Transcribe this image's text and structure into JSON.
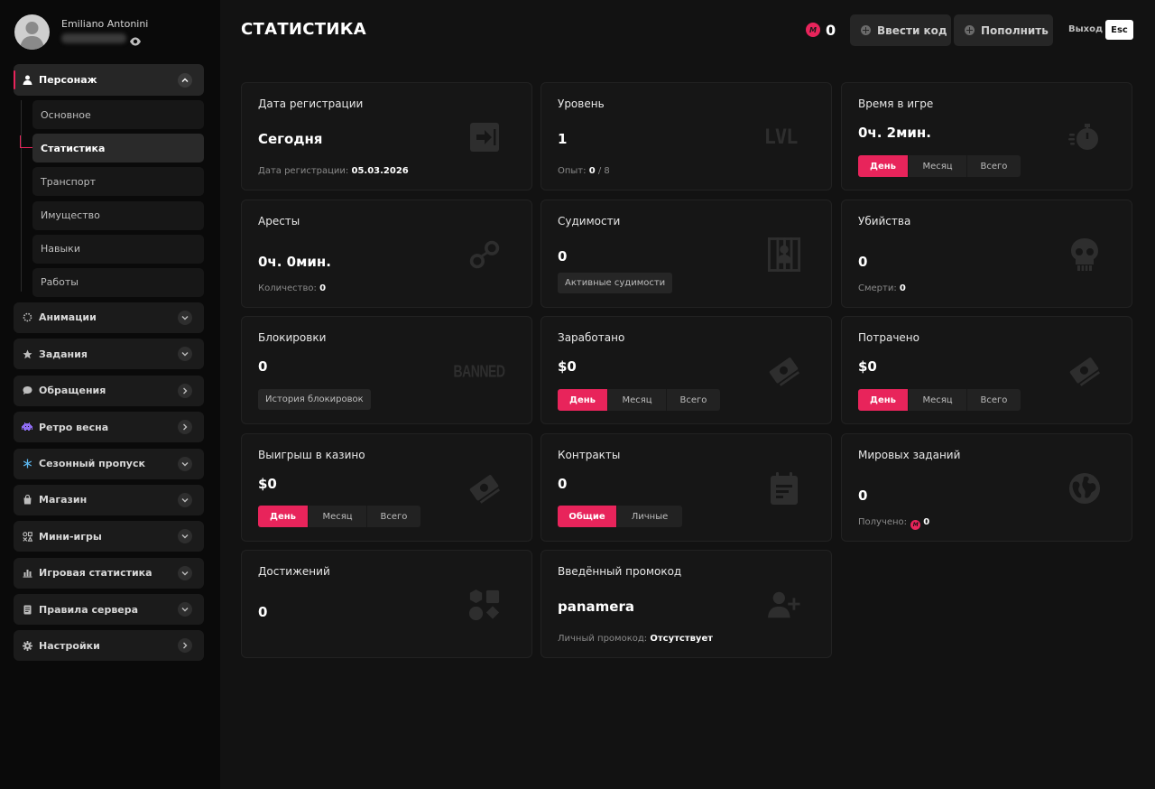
{
  "sidebar": {
    "profile": {
      "name": "Emiliano Antonini"
    },
    "menu": [
      {
        "label": "Персонаж"
      },
      {
        "label": "Анимации"
      },
      {
        "label": "Задания"
      },
      {
        "label": "Обращения"
      },
      {
        "label": "Ретро весна"
      },
      {
        "label": "Сезонный пропуск"
      },
      {
        "label": "Магазин"
      },
      {
        "label": "Мини-игры"
      },
      {
        "label": "Игровая статистика"
      },
      {
        "label": "Правила сервера"
      },
      {
        "label": "Настройки"
      }
    ],
    "submenu": [
      {
        "label": "Основное"
      },
      {
        "label": "Статистика"
      },
      {
        "label": "Транспорт"
      },
      {
        "label": "Имущество"
      },
      {
        "label": "Навыки"
      },
      {
        "label": "Работы"
      }
    ]
  },
  "header": {
    "title": "СТАТИСТИКА",
    "coin_glyph": "M",
    "balance": "0",
    "enter_code": "Ввести код",
    "top_up": "Пополнить",
    "exit_label": "Выход",
    "exit_key": "Esc"
  },
  "cards": {
    "registration": {
      "title": "Дата регистрации",
      "value": "Сегодня",
      "sub_label": "Дата регистрации:",
      "sub_value": "05.03.2026"
    },
    "level": {
      "title": "Уровень",
      "value": "1",
      "sub_label": "Опыт:",
      "sub_value": "0",
      "sub_suffix": "/ 8",
      "icon_text": "LVL"
    },
    "playtime": {
      "title": "Время в игре",
      "value": "0ч. 2мин.",
      "tabs": [
        "День",
        "Месяц",
        "Всего"
      ]
    },
    "arrests": {
      "title": "Аресты",
      "value": "0ч. 0мин.",
      "sub_label": "Количество:",
      "sub_value": "0"
    },
    "convictions": {
      "title": "Судимости",
      "value": "0",
      "button": "Активные судимости"
    },
    "kills": {
      "title": "Убийства",
      "value": "0",
      "sub_label": "Смерти:",
      "sub_value": "0"
    },
    "bans": {
      "title": "Блокировки",
      "value": "0",
      "button": "История блокировок",
      "icon_text": "BANNED"
    },
    "earned": {
      "title": "Заработано",
      "value": "$0",
      "tabs": [
        "День",
        "Месяц",
        "Всего"
      ]
    },
    "spent": {
      "title": "Потрачено",
      "value": "$0",
      "tabs": [
        "День",
        "Месяц",
        "Всего"
      ]
    },
    "casino": {
      "title": "Выигрыш в казино",
      "value": "$0",
      "tabs": [
        "День",
        "Месяц",
        "Всего"
      ]
    },
    "contracts": {
      "title": "Контракты",
      "value": "0",
      "tabs": [
        "Общие",
        "Личные"
      ]
    },
    "world_tasks": {
      "title": "Мировых заданий",
      "value": "0",
      "sub_label": "Получено:",
      "sub_value": "0"
    },
    "achievements": {
      "title": "Достижений",
      "value": "0"
    },
    "promo": {
      "title": "Введённый промокод",
      "value": "panamera",
      "sub_label": "Личный промокод:",
      "sub_value": "Отсутствует"
    }
  },
  "colors": {
    "accent": "#e8245b",
    "card": "#161616",
    "background": "#121212"
  }
}
